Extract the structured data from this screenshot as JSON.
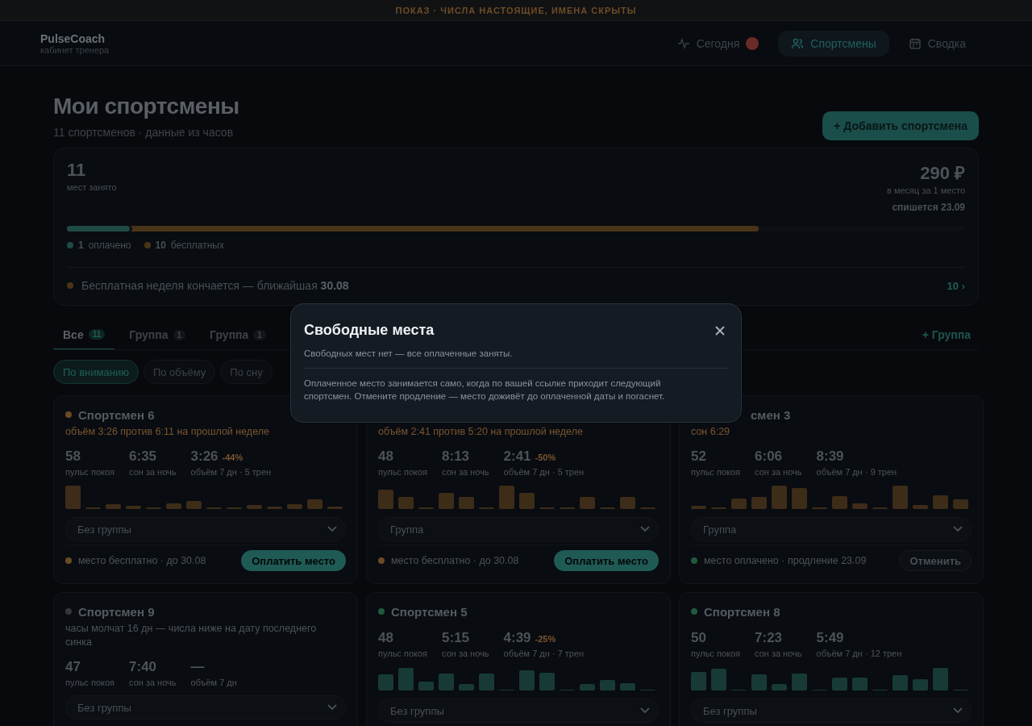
{
  "banner": "ПОКАЗ · ЧИСЛА НАСТОЯЩИЕ, ИМЕНА СКРЫТЫ",
  "brand": {
    "name": "PulseCoach",
    "subtitle": "кабинет тренера"
  },
  "nav": [
    {
      "kind": "pulse",
      "label": "Сегодня",
      "selected": false,
      "alert": true
    },
    {
      "kind": "people",
      "label": "Спортсмены",
      "selected": true,
      "alert": false
    },
    {
      "kind": "calendar",
      "label": "Сводка",
      "selected": false,
      "alert": false
    }
  ],
  "page": {
    "title": "Мои спортсмены",
    "subtitle": "11 спортсменов · данные из часов",
    "add_button": "+ Добавить спортсмена"
  },
  "seats": {
    "count": "11",
    "count_label": "мест занято",
    "price": "290 ₽",
    "price_label": "в месяц за 1 место",
    "charge": "спишется 23.09",
    "taken_bar": {
      "level": 0.77
    },
    "paid_bar": {
      "level": 0.07
    },
    "segments": [
      {
        "kind": "paid",
        "count": "1",
        "label": "оплачено"
      },
      {
        "kind": "free",
        "count": "10",
        "label": "бесплатных"
      }
    ],
    "notice": "Бесплатная неделя кончается — ближайшая **30.08**",
    "notice_link": "10 ›"
  },
  "tabs": [
    {
      "label": "Все",
      "count": "11",
      "selected": true
    },
    {
      "label": "Группа",
      "count": "1",
      "selected": false
    },
    {
      "label": "Группа",
      "count": "1",
      "selected": false
    }
  ],
  "add_group": "+ Группа",
  "sort_chips": [
    {
      "label": "По вниманию",
      "selected": true
    },
    {
      "label": "По объёму",
      "selected": false
    },
    {
      "label": "По сну",
      "selected": false
    }
  ],
  "athletes": [
    {
      "kind": "alert",
      "name": "Спортсмен 6",
      "note": "объём 3:26 против 6:11 на прошлой неделе",
      "stats": [
        {
          "value": "58",
          "label": "пульс покоя"
        },
        {
          "value": "6:35",
          "label": "сон за ночь"
        },
        {
          "value": "3:26",
          "delta": "-44%",
          "label": "объём 7 дн · 5 трен"
        }
      ],
      "group": "Без группы",
      "seat": {
        "kind": "free",
        "text": "место бесплатно · до 30.08",
        "action": "Оплатить место"
      }
    },
    {
      "kind": "alert",
      "note": "объём 2:41 против 5:20 на прошлой неделе",
      "stats": [
        {
          "value": "48",
          "label": "пульс покоя"
        },
        {
          "value": "8:13",
          "label": "сон за ночь"
        },
        {
          "value": "2:41",
          "delta": "-50%",
          "label": "объём 7 дн · 5 трен"
        }
      ],
      "group": "Группа",
      "seat": {
        "kind": "free",
        "text": "место бесплатно · до 30.08",
        "action": "Оплатить место"
      }
    },
    {
      "kind": "alert",
      "name": "смен 3",
      "name_cut": true,
      "note": "сон 6:29",
      "stats": [
        {
          "value": "52",
          "label": "пульс покоя"
        },
        {
          "value": "6:06",
          "label": "сон за ночь"
        },
        {
          "value": "8:39",
          "label": "объём 7 дн · 9 трен"
        }
      ],
      "group": "Группа",
      "seat": {
        "kind": "paid",
        "text": "место оплачено · продление 23.09",
        "action": "Отменить"
      }
    },
    {
      "kind": "stale",
      "name": "Спортсмен 9",
      "note": "часы молчат 16 дн — числа ниже на дату последнего синка",
      "stats": [
        {
          "value": "47",
          "label": "пульс покоя"
        },
        {
          "value": "7:40",
          "label": "сон за ночь"
        },
        {
          "value": "—",
          "label": "объём 7 дн"
        }
      ],
      "group": "Без группы"
    },
    {
      "kind": "ok",
      "name": "Спортсмен 5",
      "stats": [
        {
          "value": "48",
          "label": "пульс покоя"
        },
        {
          "value": "5:15",
          "label": "сон за ночь"
        },
        {
          "value": "4:39",
          "delta": "-25%",
          "label": "объём 7 дн · 7 трен"
        }
      ],
      "group": "Без группы"
    },
    {
      "kind": "ok",
      "name": "Спортсмен 8",
      "stats": [
        {
          "value": "50",
          "label": "пульс покоя"
        },
        {
          "value": "7:23",
          "label": "сон за ночь"
        },
        {
          "value": "5:49",
          "label": "объём 7 дн · 12 трен"
        }
      ],
      "group": "Без группы"
    }
  ],
  "modal": {
    "title": "Свободные места",
    "summary": "Свободных мест нет — все оплаченные заняты.",
    "text": "Оплаченное место занимается само, когда по вашей ссылке приходит следующий спортсмен. Отмените продление — место доживёт до оплаченной даты и погаснет."
  }
}
